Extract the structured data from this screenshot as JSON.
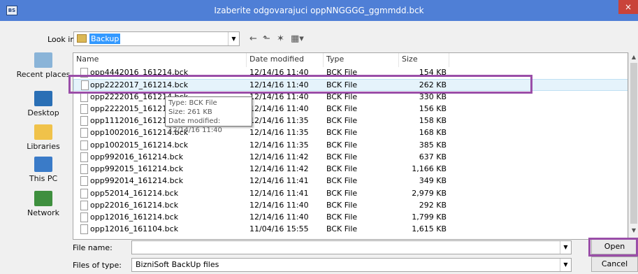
{
  "window": {
    "app_icon": "BS",
    "title": "Izaberite odgovarajuci oppNNGGGG_ggmmdd.bck",
    "close": "×"
  },
  "toolbar": {
    "look_in_label": "Look in:",
    "look_in_value": "Backup",
    "combo_arrow": "▼",
    "back_icon": "←",
    "up_icon": "⬑",
    "new_folder_icon": "✶",
    "view_icon": "▦▾"
  },
  "places": [
    {
      "label": "Recent places",
      "icon": "recent-places-icon",
      "color": "#8ab4d8"
    },
    {
      "label": "Desktop",
      "icon": "desktop-icon",
      "color": "#2a6fb5"
    },
    {
      "label": "Libraries",
      "icon": "libraries-icon",
      "color": "#f0c24a"
    },
    {
      "label": "This PC",
      "icon": "this-pc-icon",
      "color": "#3a7bc8"
    },
    {
      "label": "Network",
      "icon": "network-icon",
      "color": "#3e8f3e"
    }
  ],
  "columns": {
    "name": "Name",
    "date": "Date modified",
    "type": "Type",
    "size": "Size"
  },
  "files": [
    {
      "name": "opp4442016_161214.bck",
      "date": "12/14/16 11:40",
      "type": "BCK File",
      "size": "154 KB"
    },
    {
      "name": "opp2222017_161214.bck",
      "date": "12/14/16 11:40",
      "type": "BCK File",
      "size": "262 KB"
    },
    {
      "name": "opp2222016_161214.bck",
      "date": "12/14/16 11:40",
      "type": "BCK File",
      "size": "330 KB"
    },
    {
      "name": "opp2222015_161214.bck",
      "date": "12/14/16 11:40",
      "type": "BCK File",
      "size": "156 KB"
    },
    {
      "name": "opp1112016_161214.bck",
      "date": "12/14/16 11:35",
      "type": "BCK File",
      "size": "158 KB"
    },
    {
      "name": "opp1002016_161214.bck",
      "date": "12/14/16 11:35",
      "type": "BCK File",
      "size": "168 KB"
    },
    {
      "name": "opp1002015_161214.bck",
      "date": "12/14/16 11:35",
      "type": "BCK File",
      "size": "385 KB"
    },
    {
      "name": "opp992016_161214.bck",
      "date": "12/14/16 11:42",
      "type": "BCK File",
      "size": "637 KB"
    },
    {
      "name": "opp992015_161214.bck",
      "date": "12/14/16 11:42",
      "type": "BCK File",
      "size": "1,166 KB"
    },
    {
      "name": "opp992014_161214.bck",
      "date": "12/14/16 11:41",
      "type": "BCK File",
      "size": "349 KB"
    },
    {
      "name": "opp52014_161214.bck",
      "date": "12/14/16 11:41",
      "type": "BCK File",
      "size": "2,979 KB"
    },
    {
      "name": "opp22016_161214.bck",
      "date": "12/14/16 11:40",
      "type": "BCK File",
      "size": "292 KB"
    },
    {
      "name": "opp12016_161214.bck",
      "date": "12/14/16 11:40",
      "type": "BCK File",
      "size": "1,799 KB"
    },
    {
      "name": "opp12016_161104.bck",
      "date": "11/04/16 15:55",
      "type": "BCK File",
      "size": "1,615 KB"
    }
  ],
  "tooltip": {
    "type_line": "Type: BCK File",
    "size_line": "Size: 261 KB",
    "date_line": "Date modified: 12/14/16 11:40"
  },
  "scroll": {
    "up": "▲",
    "down": "▼"
  },
  "bottom": {
    "file_name_label": "File name:",
    "file_name_value": "",
    "files_of_type_label": "Files of type:",
    "files_of_type_value": "BizniSoft BackUp files",
    "dropdown_arrow": "▼",
    "open_label": "Open",
    "cancel_label": "Cancel"
  }
}
